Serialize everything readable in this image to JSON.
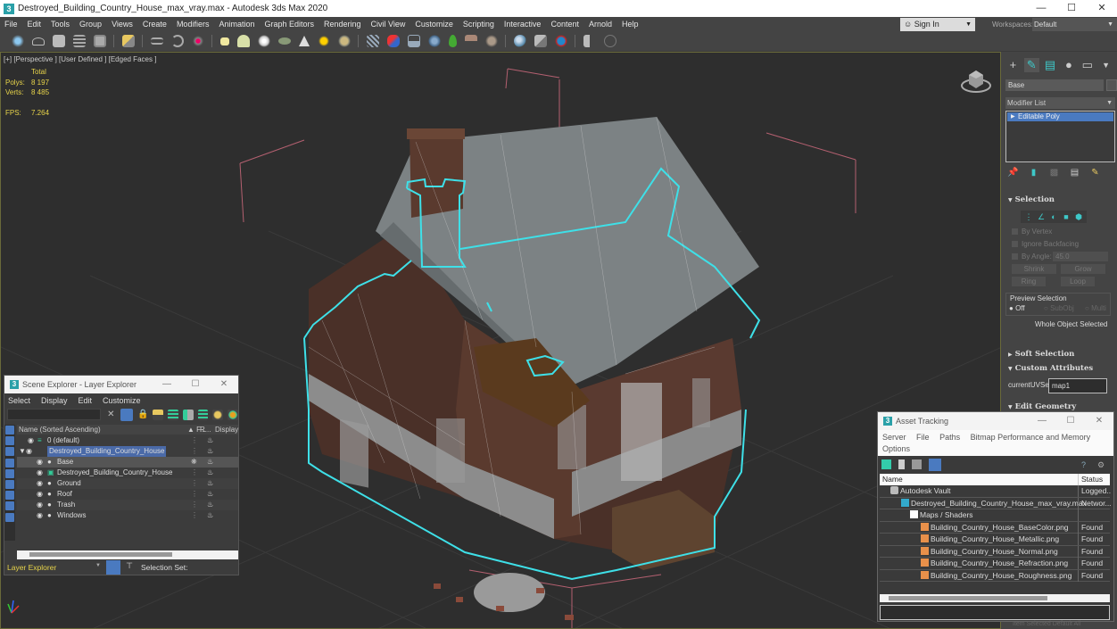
{
  "window": {
    "title": "Destroyed_Building_Country_House_max_vray.max - Autodesk 3ds Max 2020",
    "controls": [
      "minimize",
      "maximize",
      "close"
    ]
  },
  "menubar": {
    "items": [
      "File",
      "Edit",
      "Tools",
      "Group",
      "Views",
      "Create",
      "Modifiers",
      "Animation",
      "Graph Editors",
      "Rendering",
      "Civil View",
      "Customize",
      "Scripting",
      "Interactive",
      "Content",
      "Arnold",
      "Help"
    ],
    "sign_in": "Sign In",
    "workspaces_label": "Workspaces:",
    "workspace_value": "Default"
  },
  "toolbar": {
    "icons": [
      "undo-scene-icon",
      "redo-scene-icon",
      "open-explorer-icon",
      "layer-manager-icon",
      "ribbon-icon",
      "snap-icon",
      "mirror-icon",
      "align-icon",
      "curve-editor-icon",
      "box-icon",
      "sphere-icon",
      "light-icon",
      "camera-icon",
      "cone-icon",
      "sun-icon",
      "material-icon",
      "bone-icon",
      "link-icon",
      "schematic-icon",
      "globe-icon",
      "leaf-icon",
      "animal-icon",
      "rock-icon",
      "render-setup-icon",
      "render-frame-icon",
      "render-icon",
      "script-icon",
      "help-icon"
    ]
  },
  "viewport": {
    "label": "[+] [Perspective ] [User Defined ] [Edged Faces ]",
    "stats": {
      "header": "Total",
      "polys_label": "Polys:",
      "polys_value": "8 197",
      "verts_label": "Verts:",
      "verts_value": "8 485",
      "fps_label": "FPS:",
      "fps_value": "7.264"
    },
    "selection_color": "#3ee0e8",
    "stats_color": "#e8d44a"
  },
  "scene_explorer": {
    "title": "Scene Explorer - Layer Explorer",
    "menu": [
      "Select",
      "Display",
      "Edit",
      "Customize"
    ],
    "columns": {
      "name": "Name (Sorted Ascending)",
      "frozen": "▲ F...",
      "render": "R...",
      "display": "Display"
    },
    "rows": [
      {
        "name": "0 (default)",
        "level": 1,
        "type": "layer"
      },
      {
        "name": "Destroyed_Building_Country_House",
        "level": 0,
        "type": "layer",
        "expanded": true,
        "highlighted": true
      },
      {
        "name": "Base",
        "level": 2,
        "type": "object",
        "selected": true
      },
      {
        "name": "Destroyed_Building_Country_House",
        "level": 2,
        "type": "group"
      },
      {
        "name": "Ground",
        "level": 2,
        "type": "object"
      },
      {
        "name": "Roof",
        "level": 2,
        "type": "object"
      },
      {
        "name": "Trash",
        "level": 2,
        "type": "object"
      },
      {
        "name": "Windows",
        "level": 2,
        "type": "object"
      }
    ],
    "footer": {
      "explorer": "Layer Explorer",
      "selection_set": "Selection Set:"
    }
  },
  "command_panel": {
    "object_name": "Base",
    "modifier_list": "Modifier List",
    "stack": [
      "Editable Poly"
    ],
    "selection": {
      "title": "Selection",
      "by_vertex": "By Vertex",
      "ignore_backfacing": "Ignore Backfacing",
      "by_angle": "By Angle:",
      "angle_value": "45.0",
      "shrink": "Shrink",
      "grow": "Grow",
      "ring": "Ring",
      "loop": "Loop",
      "preview_title": "Preview Selection",
      "preview_options": [
        "Off",
        "SubObj",
        "Multi"
      ],
      "preview_value": "Off",
      "status": "Whole Object Selected"
    },
    "soft_selection": "Soft Selection",
    "custom_attributes": {
      "title": "Custom Attributes",
      "uvset_label": "currentUVSet",
      "uvset_value": "map1"
    },
    "edit_geometry": "Edit Geometry"
  },
  "asset_tracking": {
    "title": "Asset Tracking",
    "menu_row1": [
      "Server",
      "File",
      "Paths",
      "Bitmap Performance and Memory"
    ],
    "menu_row2": [
      "Options"
    ],
    "columns": {
      "name": "Name",
      "status": "Status"
    },
    "rows": [
      {
        "name": "Autodesk Vault",
        "status": "Logged..",
        "level": 0
      },
      {
        "name": "Destroyed_Building_Country_House_max_vray.max",
        "status": "Networ...",
        "level": 1
      },
      {
        "name": "Maps / Shaders",
        "status": "",
        "level": 2
      },
      {
        "name": "Building_Country_House_BaseColor.png",
        "status": "Found",
        "level": 3
      },
      {
        "name": "Building_Country_House_Metallic.png",
        "status": "Found",
        "level": 3
      },
      {
        "name": "Building_Country_House_Normal.png",
        "status": "Found",
        "level": 3
      },
      {
        "name": "Building_Country_House_Refraction.png",
        "status": "Found",
        "level": 3
      },
      {
        "name": "Building_Country_House_Roughness.png",
        "status": "Found",
        "level": 3
      }
    ]
  },
  "statusbar": {
    "hint": "Item Selected   Default All"
  }
}
